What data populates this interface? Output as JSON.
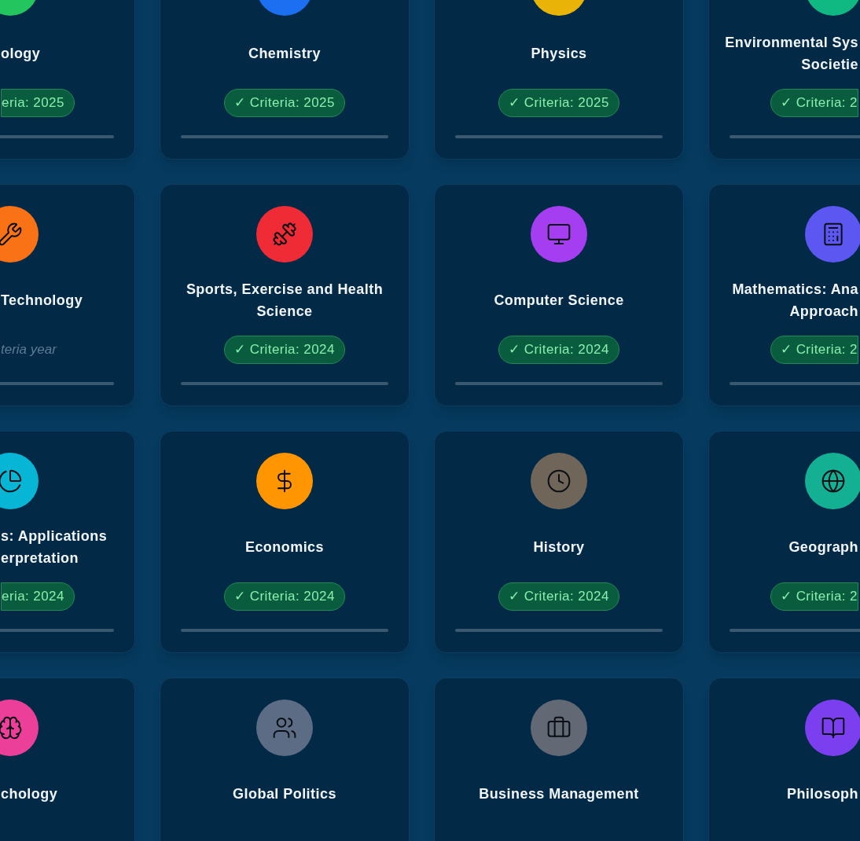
{
  "rows": [
    {
      "cards": [
        {
          "color": "#22c55e",
          "title": "ology",
          "badge": {
            "kind": "criteria",
            "text": "eria: 2025"
          }
        },
        {
          "color": "#1d6ff2",
          "title": "Chemistry",
          "badge": {
            "kind": "criteria",
            "text": "✓ Criteria: 2025"
          }
        },
        {
          "color": "#eab308",
          "title": "Physics",
          "badge": {
            "kind": "criteria",
            "text": "✓ Criteria: 2025"
          }
        },
        {
          "color": "#10b981",
          "title_lines": [
            "Environmental Sys",
            "Societie"
          ],
          "badge": {
            "kind": "criteria",
            "text": "✓ Criteria: 2"
          }
        }
      ]
    },
    {
      "cards": [
        {
          "color": "#f97316",
          "title": "Technology",
          "badge": {
            "kind": "none",
            "text": "teria year"
          }
        },
        {
          "color": "#ef2b35",
          "title": "Sports, Exercise and Health Science",
          "badge": {
            "kind": "criteria",
            "text": "✓ Criteria: 2024"
          }
        },
        {
          "color": "#a43ef0",
          "title": "Computer Science",
          "badge": {
            "kind": "criteria",
            "text": "✓ Criteria: 2024"
          }
        },
        {
          "color": "#5b57f0",
          "title_lines": [
            "Mathematics: Ana",
            "Approach"
          ],
          "badge": {
            "kind": "criteria",
            "text": "✓ Criteria: 2"
          }
        }
      ]
    },
    {
      "cards": [
        {
          "color": "#06b6d4",
          "title_lines": [
            "s: Applications",
            "erpretation"
          ],
          "badge": {
            "kind": "criteria",
            "text": "eria: 2024"
          }
        },
        {
          "color": "#ff9500",
          "title": "Economics",
          "badge": {
            "kind": "criteria",
            "text": "✓ Criteria: 2024"
          }
        },
        {
          "color": "#6f6659",
          "title": "History",
          "badge": {
            "kind": "criteria",
            "text": "✓ Criteria: 2024"
          }
        },
        {
          "color": "#14b093",
          "title": "Geograph",
          "badge": {
            "kind": "criteria",
            "text": "✓ Criteria: 2"
          }
        }
      ]
    },
    {
      "cards": [
        {
          "color": "#ec3f9a",
          "title": "chology"
        },
        {
          "color": "#5c6c84",
          "title": "Global Politics"
        },
        {
          "color": "#626874",
          "title": "Business Management"
        },
        {
          "color": "#7c3ff0",
          "title": "Philosoph"
        }
      ]
    }
  ]
}
